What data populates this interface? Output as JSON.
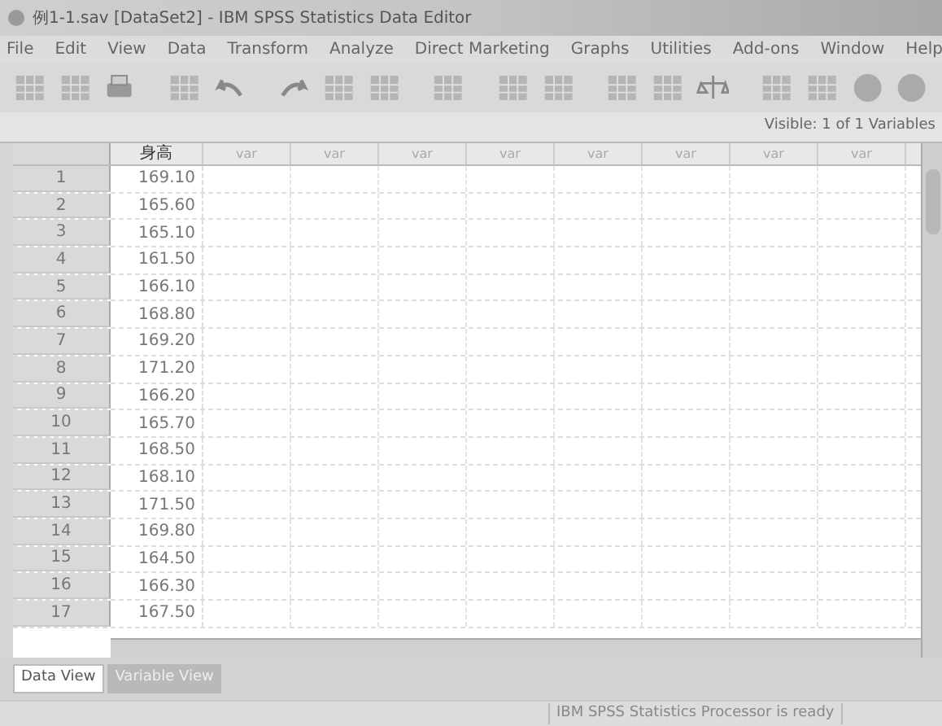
{
  "window": {
    "title": "例1-1.sav [DataSet2] - IBM SPSS Statistics Data Editor"
  },
  "menu": [
    "File",
    "Edit",
    "View",
    "Data",
    "Transform",
    "Analyze",
    "Direct Marketing",
    "Graphs",
    "Utilities",
    "Add-ons",
    "Window",
    "Help"
  ],
  "visible_label": "Visible: 1 of 1 Variables",
  "table": {
    "columns": [
      "身高",
      "var",
      "var",
      "var",
      "var",
      "var",
      "var",
      "var",
      "var"
    ],
    "rows": [
      {
        "n": "1",
        "v": "169.10"
      },
      {
        "n": "2",
        "v": "165.60"
      },
      {
        "n": "3",
        "v": "165.10"
      },
      {
        "n": "4",
        "v": "161.50"
      },
      {
        "n": "5",
        "v": "166.10"
      },
      {
        "n": "6",
        "v": "168.80"
      },
      {
        "n": "7",
        "v": "169.20"
      },
      {
        "n": "8",
        "v": "171.20"
      },
      {
        "n": "9",
        "v": "166.20"
      },
      {
        "n": "10",
        "v": "165.70"
      },
      {
        "n": "11",
        "v": "168.50"
      },
      {
        "n": "12",
        "v": "168.10"
      },
      {
        "n": "13",
        "v": "171.50"
      },
      {
        "n": "14",
        "v": "169.80"
      },
      {
        "n": "15",
        "v": "164.50"
      },
      {
        "n": "16",
        "v": "166.30"
      },
      {
        "n": "17",
        "v": "167.50"
      }
    ]
  },
  "tabs": [
    {
      "label": "Data View",
      "selected": true
    },
    {
      "label": "Variable View",
      "selected": false
    }
  ],
  "status_bar": "IBM SPSS Statistics Processor is ready"
}
